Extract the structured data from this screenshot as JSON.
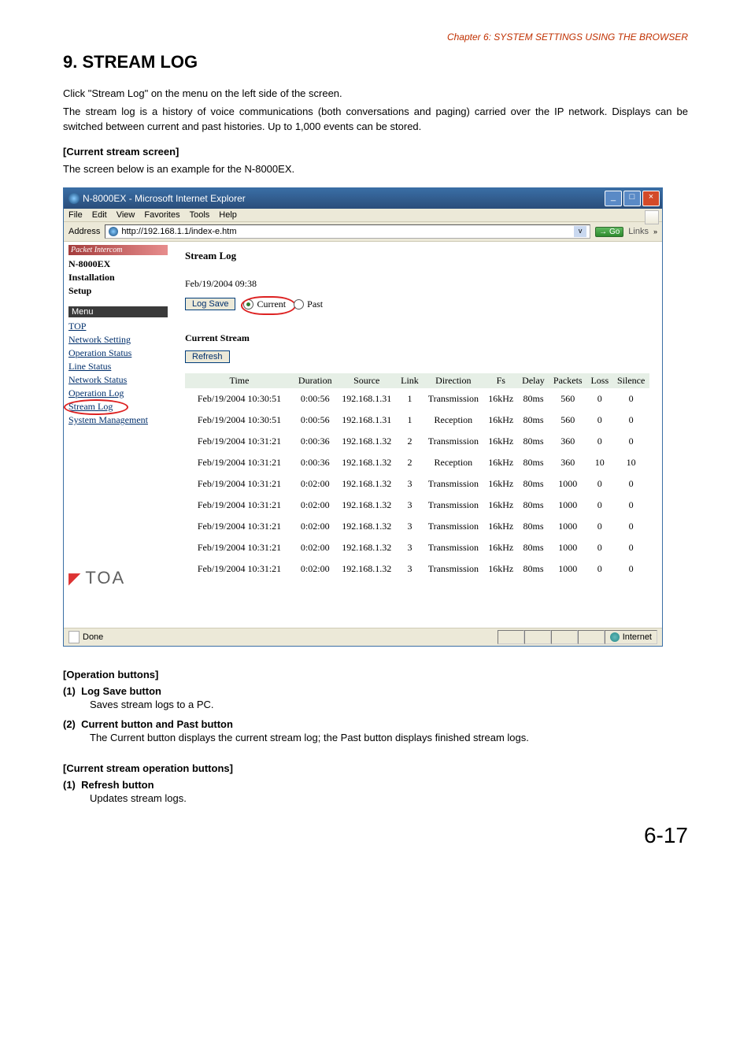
{
  "chapter": "Chapter 6:  SYSTEM SETTINGS USING THE BROWSER",
  "section_title": "9. STREAM LOG",
  "intro1": "Click \"Stream Log\" on the menu on the left side of the screen.",
  "intro2": "The stream log is a history of voice communications (both conversations and paging) carried over the IP network. Displays can be switched between current and past histories. Up to 1,000 events can be stored.",
  "current_screen_label": "[Current stream screen]",
  "current_screen_desc": "The screen below is an example for the N-8000EX.",
  "operation_buttons_label": "[Operation buttons]",
  "op1_lead": "(1)",
  "op1_title": "Log Save button",
  "op1_desc": "Saves stream logs to a PC.",
  "op2_lead": "(2)",
  "op2_title": "Current button and Past button",
  "op2_desc": "The Current button displays the current stream log; the Past button displays finished stream logs.",
  "current_op_label": "[Current stream operation buttons]",
  "cop1_lead": "(1)",
  "cop1_title": "Refresh button",
  "cop1_desc": "Updates stream logs.",
  "page_number": "6-17",
  "ie": {
    "title": "N-8000EX - Microsoft Internet Explorer",
    "menus": [
      "File",
      "Edit",
      "View",
      "Favorites",
      "Tools",
      "Help"
    ],
    "address_label": "Address",
    "url": "http://192.168.1.1/index-e.htm",
    "go_label": "Go",
    "links_label": "Links",
    "status_done": "Done",
    "status_zone": "Internet"
  },
  "sidebar": {
    "brand": "Packet Intercom",
    "title1": "N-8000EX",
    "title2": "Installation",
    "title3": "Setup",
    "menu_label": "Menu",
    "links": [
      "TOP",
      "Network Setting",
      "Operation Status",
      "Line Status",
      "Network Status",
      "Operation Log",
      "Stream Log",
      "System Management"
    ],
    "toa": "TOA"
  },
  "main": {
    "title": "Stream Log",
    "timestamp": "Feb/19/2004 09:38",
    "log_save": "Log Save",
    "current": "Current",
    "past": "Past",
    "section2": "Current Stream",
    "refresh": "Refresh",
    "columns": [
      "Time",
      "Duration",
      "Source",
      "Link",
      "Direction",
      "Fs",
      "Delay",
      "Packets",
      "Loss",
      "Silence"
    ],
    "rows": [
      [
        "Feb/19/2004 10:30:51",
        "0:00:56",
        "192.168.1.31",
        "1",
        "Transmission",
        "16kHz",
        "80ms",
        "560",
        "0",
        "0"
      ],
      [
        "Feb/19/2004 10:30:51",
        "0:00:56",
        "192.168.1.31",
        "1",
        "Reception",
        "16kHz",
        "80ms",
        "560",
        "0",
        "0"
      ],
      [
        "Feb/19/2004 10:31:21",
        "0:00:36",
        "192.168.1.32",
        "2",
        "Transmission",
        "16kHz",
        "80ms",
        "360",
        "0",
        "0"
      ],
      [
        "Feb/19/2004 10:31:21",
        "0:00:36",
        "192.168.1.32",
        "2",
        "Reception",
        "16kHz",
        "80ms",
        "360",
        "10",
        "10"
      ],
      [
        "Feb/19/2004 10:31:21",
        "0:02:00",
        "192.168.1.32",
        "3",
        "Transmission",
        "16kHz",
        "80ms",
        "1000",
        "0",
        "0"
      ],
      [
        "Feb/19/2004 10:31:21",
        "0:02:00",
        "192.168.1.32",
        "3",
        "Transmission",
        "16kHz",
        "80ms",
        "1000",
        "0",
        "0"
      ],
      [
        "Feb/19/2004 10:31:21",
        "0:02:00",
        "192.168.1.32",
        "3",
        "Transmission",
        "16kHz",
        "80ms",
        "1000",
        "0",
        "0"
      ],
      [
        "Feb/19/2004 10:31:21",
        "0:02:00",
        "192.168.1.32",
        "3",
        "Transmission",
        "16kHz",
        "80ms",
        "1000",
        "0",
        "0"
      ],
      [
        "Feb/19/2004 10:31:21",
        "0:02:00",
        "192.168.1.32",
        "3",
        "Transmission",
        "16kHz",
        "80ms",
        "1000",
        "0",
        "0"
      ]
    ]
  }
}
